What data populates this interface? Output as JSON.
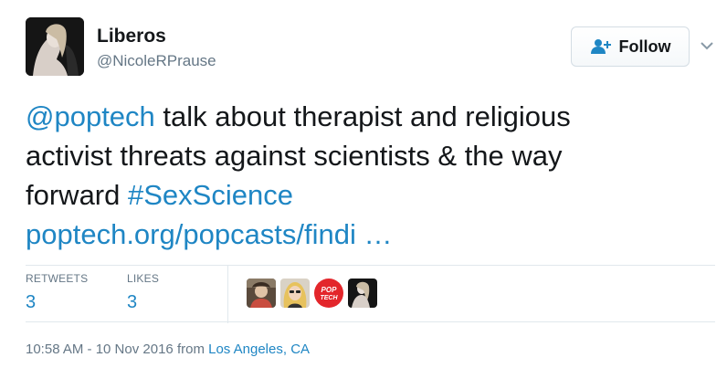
{
  "author": {
    "display_name": "Liberos",
    "handle": "@NicoleRPrause"
  },
  "follow_button": {
    "label": "Follow",
    "icon": "add-user-icon"
  },
  "menu_icon": "chevron-down-icon",
  "tweet": {
    "line1": {
      "mention": "@poptech",
      "text": " talk about therapist and religious"
    },
    "line2": "activist threats against scientists & the way",
    "line3": {
      "text": "forward ",
      "hashtag": "#SexScience"
    },
    "link": "poptech.org/popcasts/findi …"
  },
  "stats": {
    "retweets_label": "RETWEETS",
    "retweets_count": "3",
    "likes_label": "LIKES",
    "likes_count": "3"
  },
  "liker_avatars": [
    {
      "name": "liker-avatar-1"
    },
    {
      "name": "liker-avatar-2"
    },
    {
      "name": "liker-avatar-poptech",
      "text_line1": "POP",
      "text_line2": "TECH"
    },
    {
      "name": "liker-avatar-4"
    }
  ],
  "footer": {
    "time": "10:58 AM - 10 Nov 2016",
    "from": " from ",
    "location": "Los Angeles, CA"
  },
  "colors": {
    "link": "#1f86c4",
    "muted": "#657786",
    "text": "#14171a",
    "divider": "#e1e8ed",
    "poptech_red": "#e3262b"
  }
}
